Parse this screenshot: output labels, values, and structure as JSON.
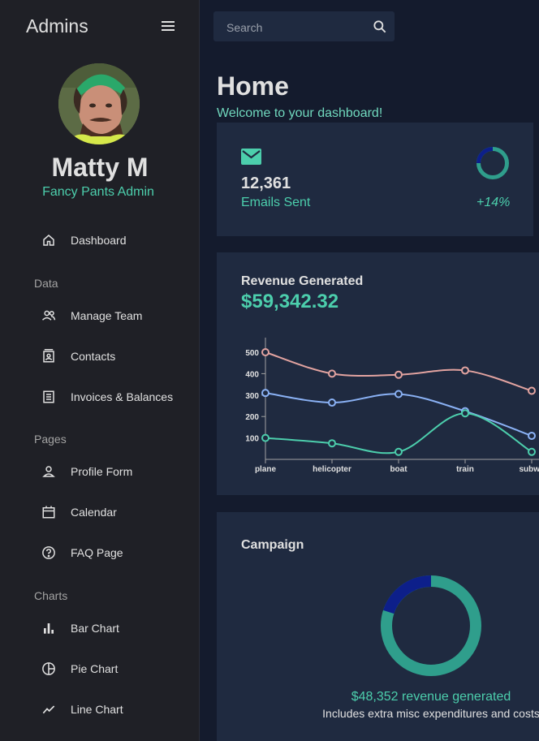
{
  "sidebar": {
    "title": "Admins",
    "user": {
      "name": "Matty M",
      "role": "Fancy Pants Admin"
    },
    "items": [
      {
        "label": "Dashboard",
        "icon": "home-icon"
      },
      {
        "label": "Manage Team",
        "icon": "people-icon"
      },
      {
        "label": "Contacts",
        "icon": "contacts-icon"
      },
      {
        "label": "Invoices & Balances",
        "icon": "receipt-icon"
      },
      {
        "label": "Profile Form",
        "icon": "person-icon"
      },
      {
        "label": "Calendar",
        "icon": "calendar-icon"
      },
      {
        "label": "FAQ Page",
        "icon": "help-icon"
      },
      {
        "label": "Bar Chart",
        "icon": "bar-chart-icon"
      },
      {
        "label": "Pie Chart",
        "icon": "pie-chart-icon"
      },
      {
        "label": "Line Chart",
        "icon": "line-chart-icon"
      }
    ],
    "sections": [
      "Data",
      "Pages",
      "Charts"
    ]
  },
  "search": {
    "placeholder": "Search"
  },
  "header": {
    "title": "Home",
    "subtitle": "Welcome to your dashboard!"
  },
  "stat": {
    "value": "12,361",
    "label": "Emails Sent",
    "increase": "+14%",
    "progress": 0.25
  },
  "revenue": {
    "title": "Revenue Generated",
    "value": "$59,342.32"
  },
  "campaign": {
    "title": "Campaign",
    "revenue_text": "$48,352 revenue generated",
    "note": "Includes extra misc expenditures and costs",
    "progress": 0.2
  },
  "colors": {
    "accent": "#4cceac",
    "card": "#1f2a40",
    "background": "#141b2d",
    "sidebar": "#1f2026",
    "series_red": "#e2a3a0",
    "series_blue": "#8ab1f4",
    "series_green": "#4cceac",
    "progress_dark": "#0d1f8a",
    "progress_ring": "#2f9e8c"
  },
  "chart_data": {
    "type": "line",
    "categories": [
      "plane",
      "helicopter",
      "boat",
      "train",
      "subwa"
    ],
    "series": [
      {
        "values": [
          500,
          400,
          395,
          415,
          320
        ]
      },
      {
        "values": [
          310,
          265,
          305,
          225,
          110
        ]
      },
      {
        "values": [
          100,
          75,
          35,
          215,
          35
        ]
      }
    ],
    "yticks": [
      100,
      200,
      300,
      400,
      500
    ],
    "ylim": [
      0,
      560
    ]
  }
}
